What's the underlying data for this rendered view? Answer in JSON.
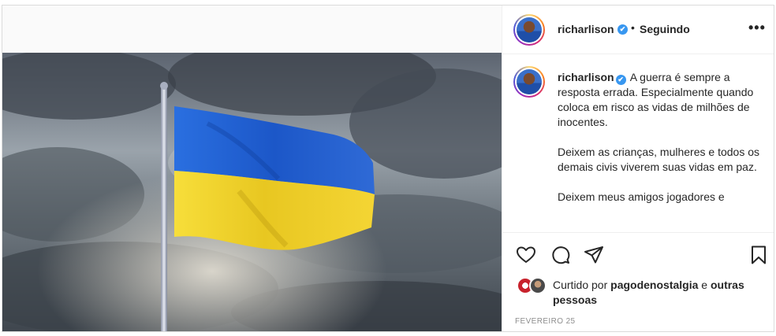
{
  "post": {
    "username": "richarlison",
    "verified_mark": "✔",
    "dot": "•",
    "follow_status": "Seguindo",
    "more_label": "•••",
    "caption_paragraphs": [
      "A guerra é sempre a resposta errada. Especialmente quando coloca em risco as vidas de milhões de inocentes.",
      "Deixem as crianças, mulheres e todos os demais civis viverem suas vidas em paz.",
      "Deixem meus amigos jogadores e"
    ],
    "liked_prefix": "Curtido por",
    "liked_user": "pagodenostalgia",
    "liked_and": "e",
    "liked_others": "outras pessoas",
    "date": "FEVEREIRO 25"
  },
  "icons": [
    "heart-icon",
    "comment-icon",
    "share-icon",
    "bookmark-icon",
    "more-options-icon",
    "verified-icon"
  ],
  "colors": {
    "flag_blue": "#1f5fd0",
    "flag_yellow": "#f3d52a",
    "verified": "#3897f0",
    "muted": "#8e8e8e"
  }
}
